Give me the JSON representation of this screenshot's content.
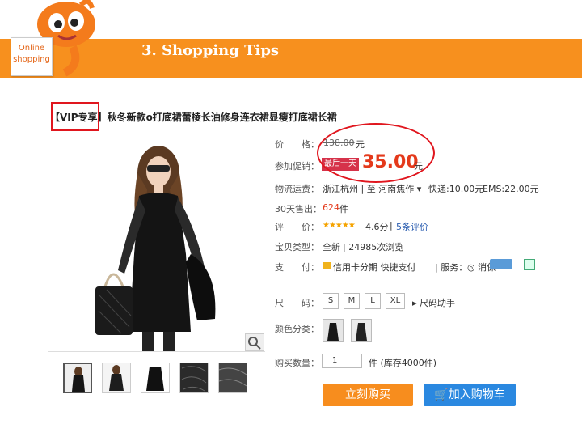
{
  "header": {
    "slide_title": "3. Shopping Tips",
    "badge_line1": "Online",
    "badge_line2": "shopping",
    "accent_color": "#f7901e"
  },
  "product": {
    "vip_tag": "【VIP专享】",
    "title": "秋冬新款o打底裙蕾棱长油修身连衣裙显瘦打底裙长裙"
  },
  "details": {
    "price_label": "价　　格：",
    "price_old": "138.00",
    "price_unit": "元",
    "promo_label": "参加促销：",
    "promo_tag": "最后一天",
    "promo_price": "35.00",
    "promo_unit": "元",
    "shipping_label": "物流运费：",
    "shipping_route": "浙江杭州 | 至 河南焦作 ▾",
    "express": "快递:10.00元",
    "ems": "EMS:22.00元",
    "sold_label": "30天售出：",
    "sold_value": "624",
    "sold_unit": "件",
    "rating_label": "评　　价：",
    "stars": "★★★★★",
    "rating_score": "4.6分",
    "rating_sep": "|",
    "reviews": "5条评价",
    "type_label": "宝贝类型：",
    "type_value": "全新",
    "views": "| 24985次浏览",
    "pay_label": "支　　付：",
    "pay_value": "信用卡分期 快捷支付",
    "service_label": "| 服务：",
    "service_value": "◎ 消保"
  },
  "options": {
    "size_label": "尺　　码：",
    "sizes": [
      "S",
      "M",
      "L",
      "XL"
    ],
    "size_helper": "▸ 尺码助手",
    "color_label": "颜色分类：",
    "qty_label": "购买数量：",
    "qty_value": "1",
    "stock": "件 (库存4000件)"
  },
  "actions": {
    "buy_now": "立刻购买",
    "add_to_cart": "加入购物车"
  }
}
